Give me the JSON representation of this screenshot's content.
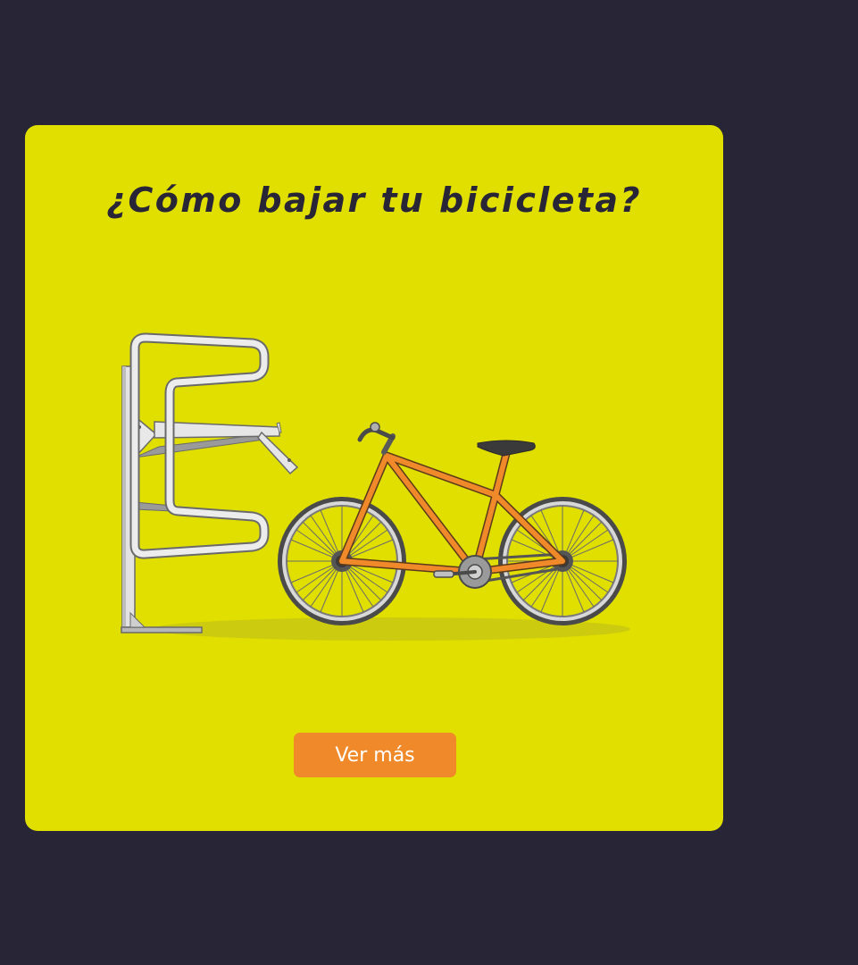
{
  "card": {
    "title": "¿Cómo bajar tu bicicleta?",
    "button_label": "Ver más"
  },
  "colors": {
    "background": "#282536",
    "card": "#e0df00",
    "button": "#f0892a",
    "bike_frame": "#f0892a",
    "rack": "#e6e6e6"
  },
  "icons": {
    "illustration": "bike-rack-with-bicycle-illustration"
  }
}
